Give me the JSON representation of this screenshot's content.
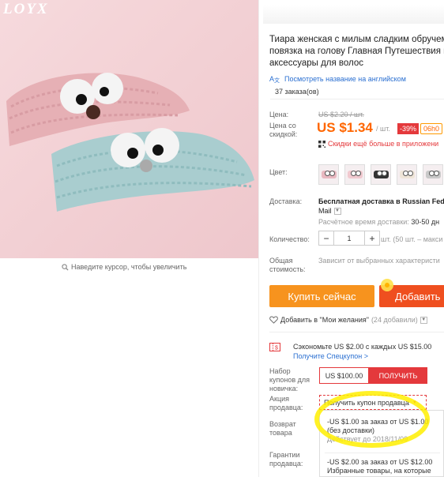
{
  "brand": {
    "logo": "LOYX"
  },
  "zoom_hint": "Наведите курсор, чтобы увеличить",
  "product": {
    "title_lines": [
      "Тиара женская с милым сладким обручем",
      "повязка на голову Главная Путешествия м",
      "аксессуары для волос"
    ],
    "translate_link": "Посмотреть название на английском",
    "orders": "37 заказа(ов)"
  },
  "price": {
    "label_price": "Цена:",
    "old_price": "US $2.20 / шт.",
    "label_discount": [
      "Цена со",
      "скидкой:"
    ],
    "new_price": "US $1.34",
    "per_unit": "/ шт.",
    "discount_badge": "-39%",
    "timer": "06h0",
    "app_discount": "Скидки ещё больше в приложени"
  },
  "color": {
    "label": "Цвет:",
    "swatches": [
      {
        "name": "pink",
        "hex": "#e9b8c0"
      },
      {
        "name": "light-pink",
        "hex": "#f1c9cf"
      },
      {
        "name": "black",
        "hex": "#333333"
      },
      {
        "name": "cream",
        "hex": "#efe5d8"
      },
      {
        "name": "gray",
        "hex": "#c9c9c9"
      }
    ]
  },
  "shipping": {
    "label": "Доставка:",
    "line1": "Бесплатная доставка в Russian Fede",
    "line2": "Mail",
    "eta_label": "Расчётное время доставки:",
    "eta_value": "30-50 дн"
  },
  "quantity": {
    "label": "Количество:",
    "minus": "−",
    "value": "1",
    "plus": "+",
    "note": "шт. (50 шт. – макси"
  },
  "total": {
    "label": [
      "Общая",
      "стоимость:"
    ],
    "note": "Зависит от выбранных характеристи"
  },
  "actions": {
    "buy_now": "Купить сейчас",
    "add_to_cart": "Добавить в",
    "wishlist": "Добавить в \"Мои желания\"",
    "wishlist_count": "(24 добавили)"
  },
  "coupons": {
    "save_text": "Сэкономьте US $2.00 с каждых US $15.00",
    "special_link": "Получите Спецкупон >",
    "newbie_label": [
      "Набор",
      "купонов для",
      "новичка:"
    ],
    "newbie_value": "US $100.00",
    "newbie_button": "ПОЛУЧИТЬ",
    "seller_label": [
      "Акция",
      "продавца:"
    ],
    "seller_button": "Получить купон продавца",
    "return_label": [
      "Возврат",
      "товара"
    ],
    "guarantee_label": [
      "Гарантии",
      "продавца:"
    ],
    "offer1_line1": "-US $1.00 за заказ от US $1.00",
    "offer1_line2": "(без доставки)",
    "offer1_valid": "Действует до 2018/11/09",
    "offer2_line1": "-US $2.00 за заказ от US $12.00",
    "offer2_line2": "Избранные товары, на которые"
  },
  "colors": {
    "accent_orange": "#f60",
    "buy_button": "#f7931e",
    "cart_button": "#ef4f1f",
    "red": "#e4393c",
    "link": "#2a6fd1",
    "highlight": "#ffee00"
  }
}
